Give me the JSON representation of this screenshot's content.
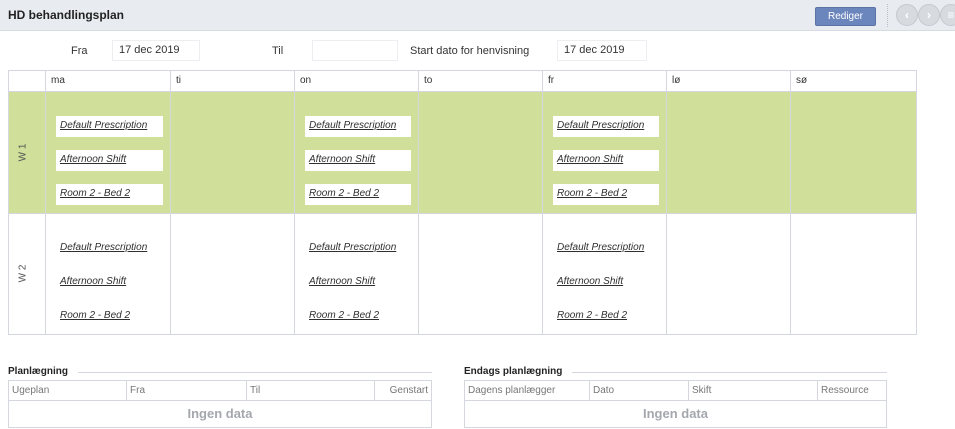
{
  "header": {
    "title": "HD behandlingsplan",
    "edit_label": "Rediger"
  },
  "filters": {
    "from_label": "Fra",
    "from_value": "17 dec 2019",
    "to_label": "Til",
    "to_value": "",
    "start_label": "Start dato for henvisning",
    "start_value": "17 dec 2019"
  },
  "schedule": {
    "days": [
      "ma",
      "ti",
      "on",
      "to",
      "fr",
      "lø",
      "sø"
    ],
    "weeks": [
      {
        "label": "W 1",
        "highlighted": true,
        "entries": [
          {
            "day": "ma",
            "prescription": "Default Prescription",
            "shift": "Afternoon Shift",
            "location": "Room 2 - Bed 2"
          },
          {
            "day": "on",
            "prescription": "Default Prescription",
            "shift": "Afternoon Shift",
            "location": "Room 2 - Bed 2"
          },
          {
            "day": "fr",
            "prescription": "Default Prescription",
            "shift": "Afternoon Shift",
            "location": "Room 2 - Bed 2"
          }
        ]
      },
      {
        "label": "W 2",
        "highlighted": false,
        "entries": [
          {
            "day": "ma",
            "prescription": "Default Prescription",
            "shift": "Afternoon Shift",
            "location": "Room 2 - Bed 2"
          },
          {
            "day": "on",
            "prescription": "Default Prescription",
            "shift": "Afternoon Shift",
            "location": "Room 2 - Bed 2"
          },
          {
            "day": "fr",
            "prescription": "Default Prescription",
            "shift": "Afternoon Shift",
            "location": "Room 2 - Bed 2"
          }
        ]
      }
    ]
  },
  "planning": {
    "title": "Planlægning",
    "columns": [
      "Ugeplan",
      "Fra",
      "Til",
      "Genstart"
    ],
    "empty_text": "Ingen data"
  },
  "day_planning": {
    "title": "Endags planlægning",
    "columns": [
      "Dagens planlægger",
      "Dato",
      "Skift",
      "Ressource"
    ],
    "empty_text": "Ingen data"
  },
  "colors": {
    "highlight_week": "#d0e09a",
    "edit_button": "#6b86bd",
    "title_bar": "#e8ecf1"
  },
  "icons": [
    "prev-icon",
    "next-icon",
    "menu-icon"
  ]
}
